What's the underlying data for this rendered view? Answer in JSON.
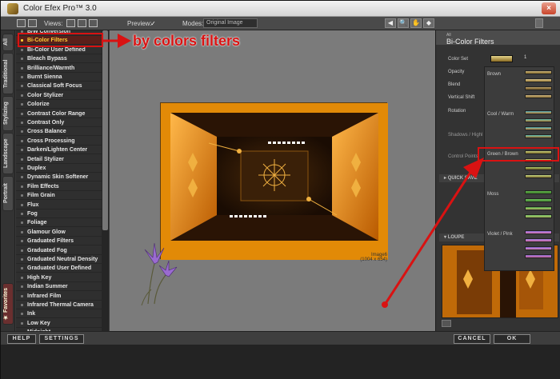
{
  "window": {
    "title": "Color Efex Pro™ 3.0",
    "close": "×"
  },
  "toolbar": {
    "views_label": "Views:",
    "preview_label": "Preview:",
    "preview_check": "✓",
    "modes_label": "Modes:",
    "modes_value": "Original Image",
    "buttons": [
      "◀",
      "🔍",
      "✋",
      "◆"
    ]
  },
  "side_tabs": [
    "All",
    "Traditional",
    "Stylizing",
    "Landscape",
    "Portrait",
    "★ Favorites"
  ],
  "filters": [
    "B/W Conversion",
    "Bi-Color Filters",
    "Bi-Color User Defined",
    "Bleach Bypass",
    "Brilliance/Warmth",
    "Burnt Sienna",
    "Classical Soft Focus",
    "Color Stylizer",
    "Colorize",
    "Contrast Color Range",
    "Contrast Only",
    "Cross Balance",
    "Cross Processing",
    "Darken/Lighten Center",
    "Detail Stylizer",
    "Duplex",
    "Dynamic Skin Softener",
    "Film Effects",
    "Film Grain",
    "Flux",
    "Fog",
    "Foliage",
    "Glamour Glow",
    "Graduated Filters",
    "Graduated Fog",
    "Graduated Neutral Density",
    "Graduated User Defined",
    "High Key",
    "Indian Summer",
    "Infrared Film",
    "Infrared Thermal Camera",
    "Ink",
    "Low Key",
    "Midnight"
  ],
  "selected_filter_index": 1,
  "preview": {
    "image_name": "Image6",
    "image_size": "(1004 x 654)"
  },
  "right_panel": {
    "sub_label": "All",
    "title": "Bi-Color Filters",
    "labels": [
      "Color Set",
      "Opacity",
      "Blend",
      "Vertical Shift",
      "Rotation",
      "Shadows / Highl",
      "Control Points"
    ],
    "color_set_value": "1",
    "quick_save": "QUICK SAVE",
    "loupe": "LOUPE"
  },
  "color_set_dropdown": {
    "groups": [
      {
        "name": "Brown",
        "swatches": [
          [
            "#c9b27a",
            "#8a6d2e"
          ],
          [
            "#d7c28c",
            "#a4843d"
          ],
          [
            "#b9a06a",
            "#6e5423"
          ],
          [
            "#cdb57f",
            "#8f7338"
          ]
        ]
      },
      {
        "name": "Cool / Warm",
        "swatches": [
          [
            "#4aa7b8",
            "#c88a3a"
          ],
          [
            "#56b6a8",
            "#b98a3f"
          ],
          [
            "#3f9fae",
            "#d19a4a"
          ],
          [
            "#5cbfb6",
            "#a97c34"
          ]
        ]
      },
      {
        "name": "Green / Brown",
        "swatches": [
          [
            "#c9d07a",
            "#7b6a2a"
          ],
          [
            "#b8cf6e",
            "#8a6f2d"
          ],
          [
            "#a9c96b",
            "#735f24"
          ],
          [
            "#c5da84",
            "#86702f"
          ]
        ]
      },
      {
        "name": "Moss",
        "swatches": [
          [
            "#5fb44a",
            "#3e7a2c"
          ],
          [
            "#6ac25a",
            "#4a8a35"
          ],
          [
            "#4fa64d",
            "#b9c064"
          ],
          [
            "#78c36a",
            "#a6b659"
          ]
        ]
      },
      {
        "name": "Violet / Pink",
        "swatches": [
          [
            "#8a6fd6",
            "#e07ab8"
          ],
          [
            "#9c7fe0",
            "#d46aa9"
          ],
          [
            "#7a5fc9",
            "#e58cc4"
          ],
          [
            "#8e70d0",
            "#cf6aa6"
          ]
        ]
      }
    ],
    "selected_group": "Green / Brown"
  },
  "bottom": {
    "help": "HELP",
    "settings": "SETTINGS",
    "cancel": "CANCEL",
    "ok": "OK"
  },
  "annotation": {
    "text": "by colors filters"
  },
  "colors": {
    "accent": "#ffcc33",
    "annotation_red": "#d91212",
    "image_orange": "#e28a07"
  }
}
